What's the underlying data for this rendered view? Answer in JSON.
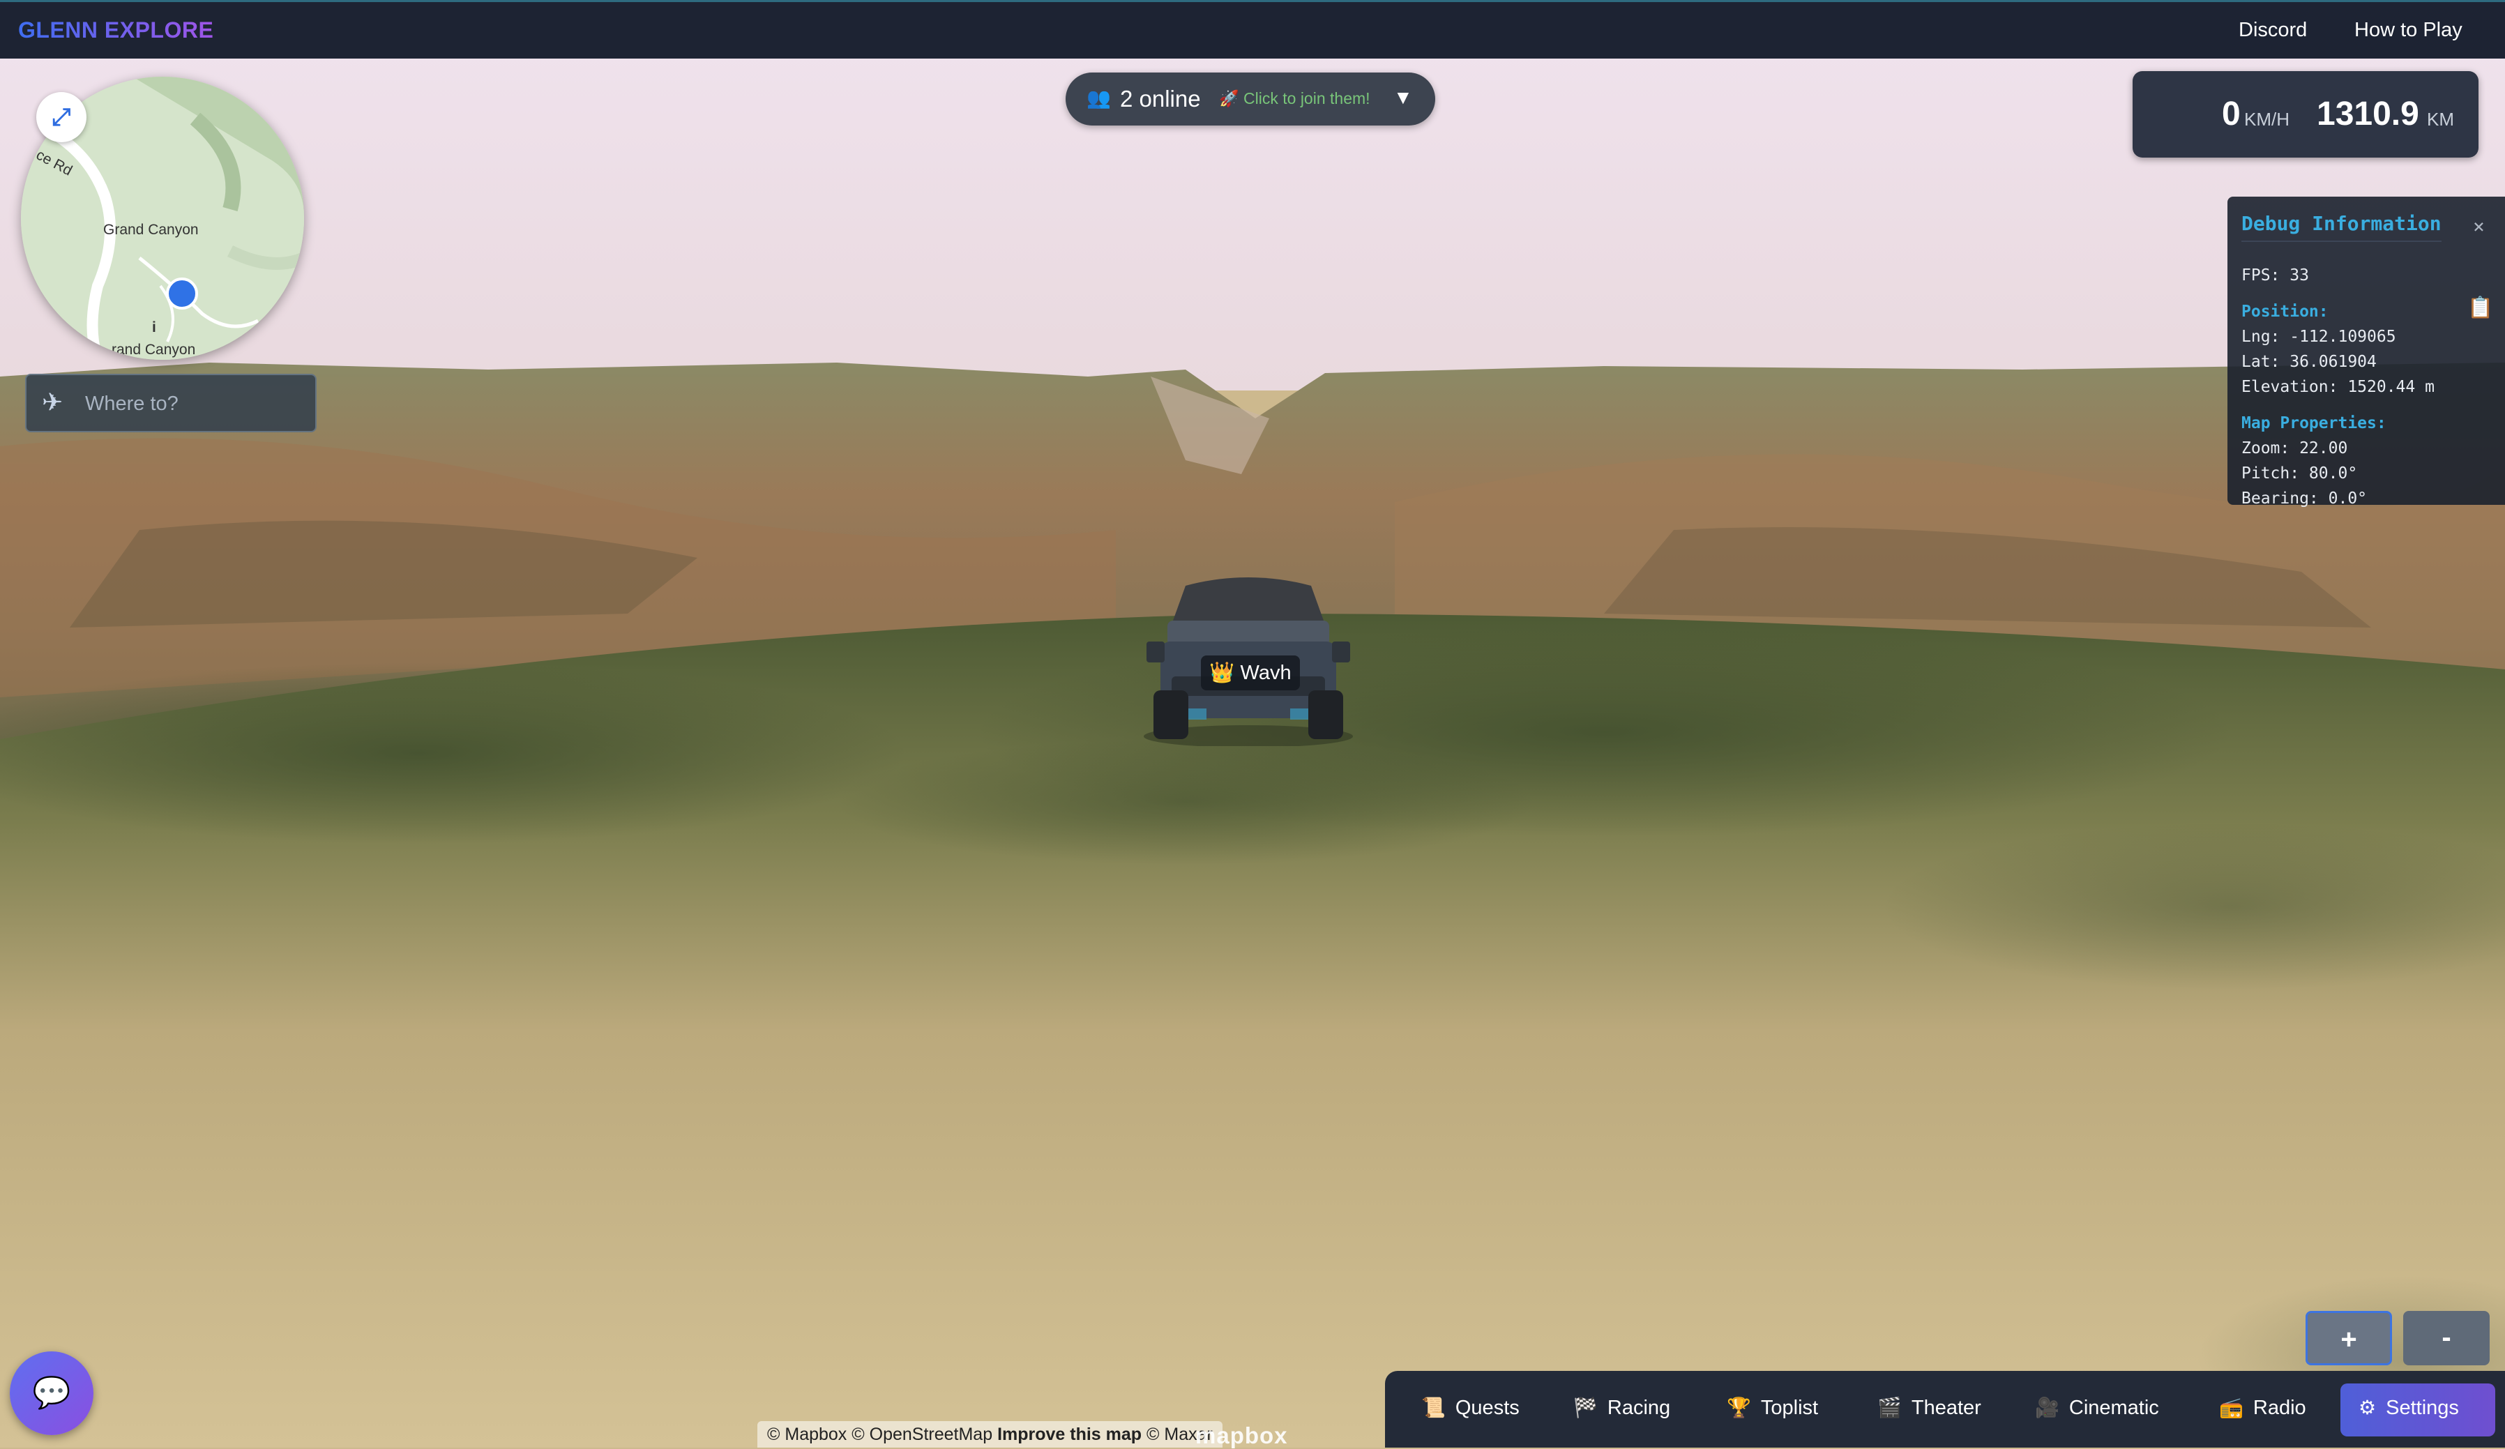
{
  "brand": {
    "title": "GLENN EXPLORE"
  },
  "nav": {
    "discord": "Discord",
    "how_to_play": "How to Play"
  },
  "minimap": {
    "expand_icon": "expand-icon",
    "labels": {
      "road": "ce Rd",
      "place": "Grand Canyon",
      "place2": "rand Canyon",
      "info": "i"
    }
  },
  "search": {
    "placeholder": "Where to?",
    "icon": "airplane-icon"
  },
  "online": {
    "count_text": "2 online",
    "join_text": "Click to join them!",
    "caret": "▼"
  },
  "speedometer": {
    "speed": "0",
    "speed_unit": "KM/H",
    "distance": "1310.9",
    "distance_unit": "KM"
  },
  "debug": {
    "title": "Debug Information",
    "close": "×",
    "fps": "FPS: 33",
    "position_header": "Position:",
    "lng": "Lng: -112.109065",
    "lat": "Lat: 36.061904",
    "elevation": "Elevation: 1520.44 m",
    "map_header": "Map Properties:",
    "zoom": "Zoom: 22.00",
    "pitch": "Pitch: 80.0°",
    "bearing": "Bearing: 0.0°"
  },
  "player": {
    "name": "Wavh"
  },
  "zoom": {
    "in": "+",
    "out": "-"
  },
  "toolbar": {
    "items": [
      {
        "label": "Quests",
        "icon": "scroll-icon"
      },
      {
        "label": "Racing",
        "icon": "checkered-flag-icon"
      },
      {
        "label": "Toplist",
        "icon": "trophy-icon"
      },
      {
        "label": "Theater",
        "icon": "clapperboard-icon"
      },
      {
        "label": "Cinematic",
        "icon": "film-camera-icon"
      },
      {
        "label": "Radio",
        "icon": "radio-icon"
      },
      {
        "label": "Settings",
        "icon": "gear-icon"
      }
    ]
  },
  "attribution": {
    "text": "© Mapbox © OpenStreetMap",
    "improve": "Improve this map",
    "maxar": "© Maxar",
    "logo": "mapbox"
  },
  "colors": {
    "accent": "#4f5fd8",
    "topbar": "#1d2333",
    "debug_header": "#3aaee0"
  }
}
